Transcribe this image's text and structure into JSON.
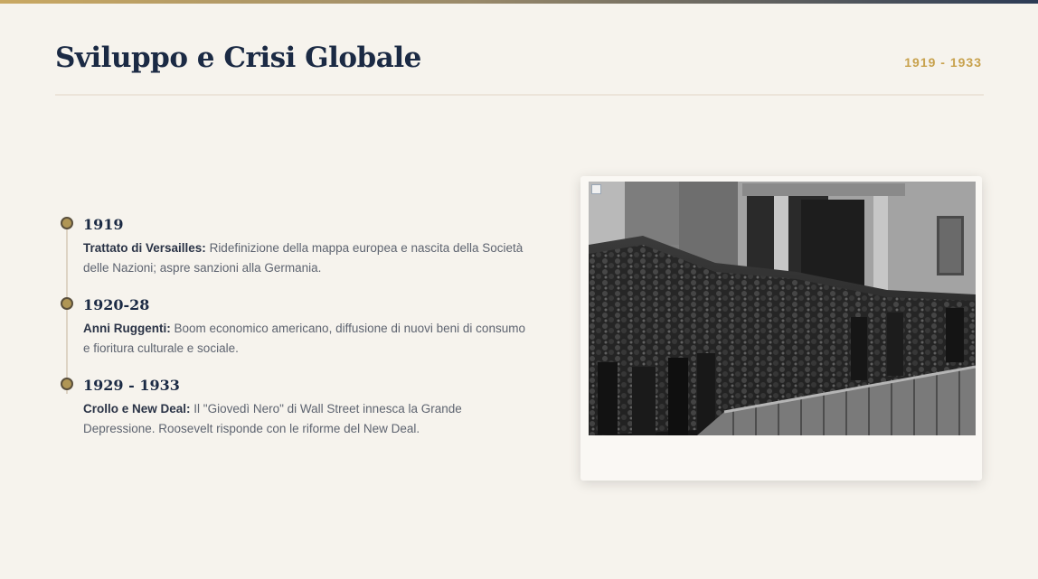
{
  "header": {
    "title": "Sviluppo e Crisi Globale",
    "date_range": "1919 - 1933"
  },
  "timeline": {
    "events": [
      {
        "year": "1919",
        "heading": "Trattato di Versailles:",
        "text": " Ridefinizione della mappa europea e nascita della Società delle Nazioni; aspre sanzioni alla Germania."
      },
      {
        "year": "1920-28",
        "heading": "Anni Ruggenti:",
        "text": " Boom economico americano, diffusione di nuovi beni di consumo e fioritura culturale e sociale."
      },
      {
        "year": "1929 - 1933",
        "heading": "Crollo e New Deal:",
        "text": " Il \"Giovedì Nero\" di Wall Street innesca la Grande Depressione. Roosevelt risponde con le riforme del New Deal."
      }
    ]
  },
  "colors": {
    "background": "#f6f3ed",
    "title": "#1b2a44",
    "accent_gold": "#c8a24e",
    "body_text": "#5e6470"
  },
  "photo": {
    "icon": "broken-image-icon"
  }
}
